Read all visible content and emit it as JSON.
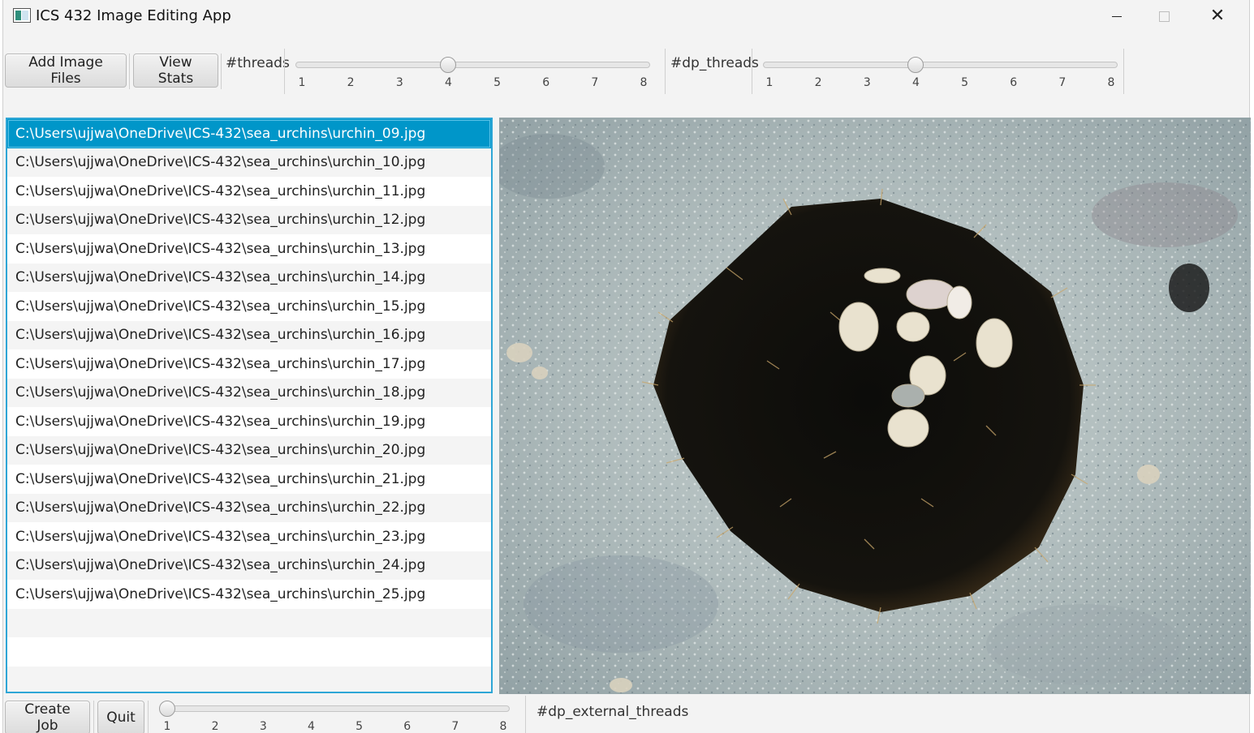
{
  "window": {
    "title": "ICS 432 Image Editing App",
    "minimize_icon": "minimize-icon",
    "maximize_icon": "maximize-icon",
    "close_icon": "close-icon",
    "close_glyph": "✕"
  },
  "toolbar": {
    "add_images_label": "Add Image Files",
    "view_stats_label": "View Stats",
    "threads_label": "#threads",
    "threads_value": 4,
    "threads_ticks": [
      "1",
      "2",
      "3",
      "4",
      "5",
      "6",
      "7",
      "8"
    ],
    "dp_threads_label": "#dp_threads",
    "dp_threads_value": 4,
    "dp_threads_ticks": [
      "1",
      "2",
      "3",
      "4",
      "5",
      "6",
      "7",
      "8"
    ]
  },
  "file_list": {
    "selected_index": 0,
    "items": [
      "C:\\Users\\ujjwa\\OneDrive\\ICS-432\\sea_urchins\\urchin_09.jpg",
      "C:\\Users\\ujjwa\\OneDrive\\ICS-432\\sea_urchins\\urchin_10.jpg",
      "C:\\Users\\ujjwa\\OneDrive\\ICS-432\\sea_urchins\\urchin_11.jpg",
      "C:\\Users\\ujjwa\\OneDrive\\ICS-432\\sea_urchins\\urchin_12.jpg",
      "C:\\Users\\ujjwa\\OneDrive\\ICS-432\\sea_urchins\\urchin_13.jpg",
      "C:\\Users\\ujjwa\\OneDrive\\ICS-432\\sea_urchins\\urchin_14.jpg",
      "C:\\Users\\ujjwa\\OneDrive\\ICS-432\\sea_urchins\\urchin_15.jpg",
      "C:\\Users\\ujjwa\\OneDrive\\ICS-432\\sea_urchins\\urchin_16.jpg",
      "C:\\Users\\ujjwa\\OneDrive\\ICS-432\\sea_urchins\\urchin_17.jpg",
      "C:\\Users\\ujjwa\\OneDrive\\ICS-432\\sea_urchins\\urchin_18.jpg",
      "C:\\Users\\ujjwa\\OneDrive\\ICS-432\\sea_urchins\\urchin_19.jpg",
      "C:\\Users\\ujjwa\\OneDrive\\ICS-432\\sea_urchins\\urchin_20.jpg",
      "C:\\Users\\ujjwa\\OneDrive\\ICS-432\\sea_urchins\\urchin_21.jpg",
      "C:\\Users\\ujjwa\\OneDrive\\ICS-432\\sea_urchins\\urchin_22.jpg",
      "C:\\Users\\ujjwa\\OneDrive\\ICS-432\\sea_urchins\\urchin_23.jpg",
      "C:\\Users\\ujjwa\\OneDrive\\ICS-432\\sea_urchins\\urchin_24.jpg",
      "C:\\Users\\ujjwa\\OneDrive\\ICS-432\\sea_urchins\\urchin_25.jpg",
      "",
      "",
      ""
    ]
  },
  "bottom": {
    "create_job_label": "Create Job",
    "quit_label": "Quit",
    "external_threads_value": 1,
    "external_threads_ticks": [
      "1",
      "2",
      "3",
      "4",
      "5",
      "6",
      "7",
      "8"
    ],
    "external_threads_label": "#dp_external_threads"
  },
  "colors": {
    "selection": "#0096c9",
    "list_border": "#2ea6d6"
  }
}
